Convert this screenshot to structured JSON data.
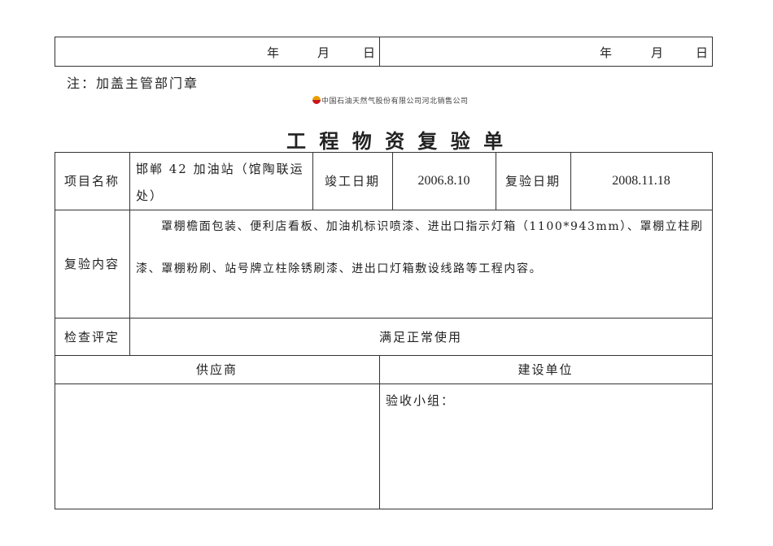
{
  "top_sign_row": {
    "left": {
      "year": "年",
      "month": "月",
      "day": "日"
    },
    "right": {
      "year": "年",
      "month": "月",
      "day": "日"
    }
  },
  "note": "注：加盖主管部门章",
  "company": "中国石油天然气股份有限公司河北销售公司",
  "title": "工 程 物 资 复 验 单",
  "table": {
    "project_name_label": "项目名称",
    "project_name_line1": "邯郸 42 加油站（馆陶联运",
    "project_name_line2": "处）",
    "completion_date_label": "竣工日期",
    "completion_date": "2006.8.10",
    "recheck_date_label": "复验日期",
    "recheck_date": "2008.11.18",
    "content_label": "复验内容",
    "content_line1": "罩棚檐面包装、便利店看板、加油机标识喷漆、进出口指示灯箱（1100*943mm）、罩棚立柱刷",
    "content_line2": "漆、罩棚粉刷、站号牌立柱除锈刷漆、进出口灯箱敷设线路等工程内容。",
    "evaluation_label": "检查评定",
    "evaluation": "满足正常使用",
    "supplier_label": "供应商",
    "builder_label": "建设单位",
    "acceptance_group": "验收小组："
  }
}
